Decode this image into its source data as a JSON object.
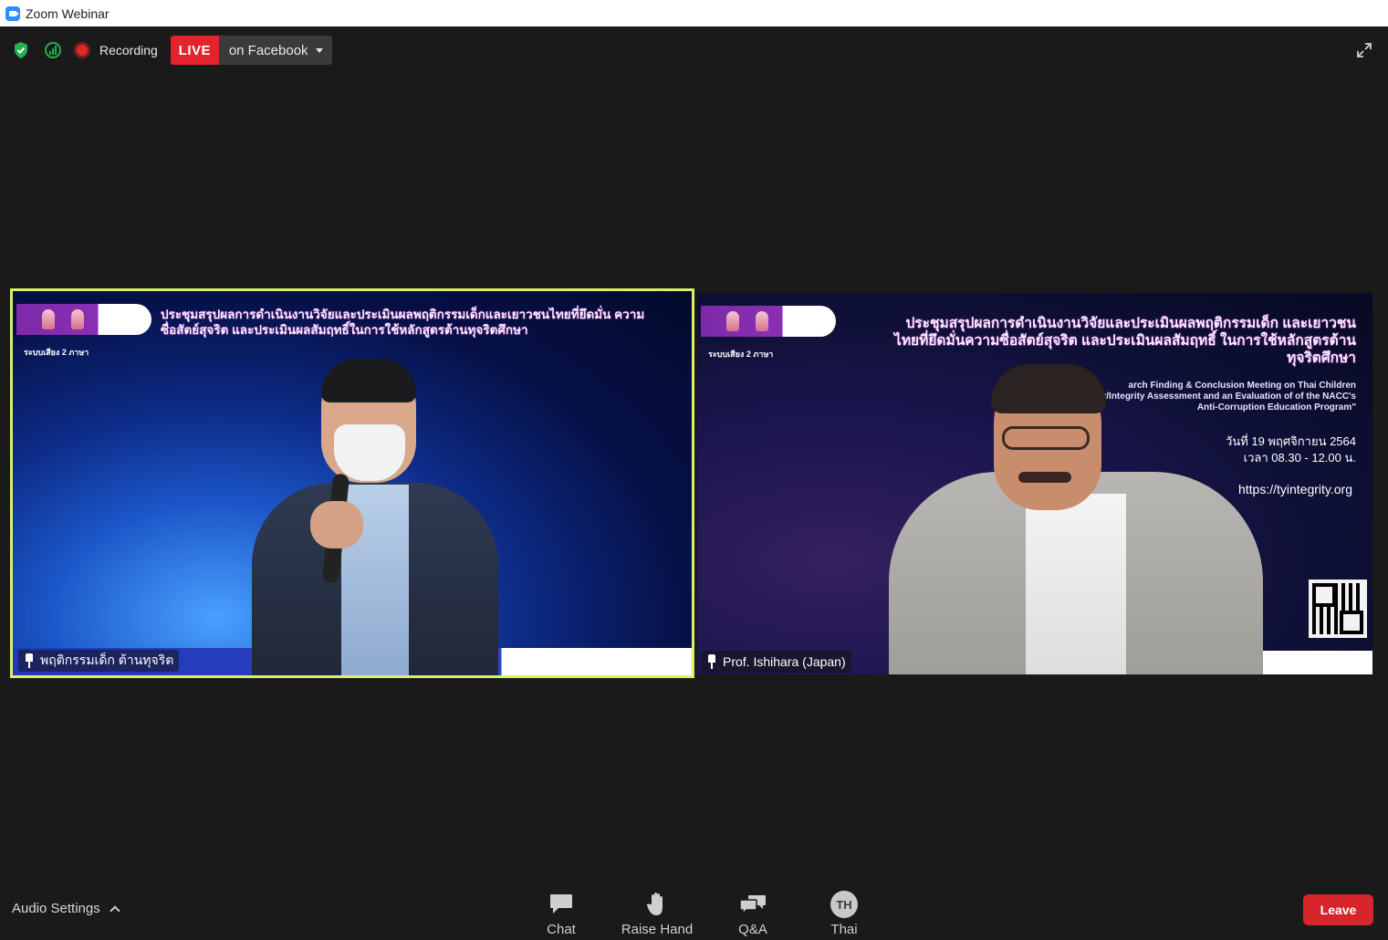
{
  "window": {
    "title": "Zoom Webinar"
  },
  "topbar": {
    "recording_label": "Recording",
    "live_badge": "LIVE",
    "live_destination": "on Facebook"
  },
  "tiles": [
    {
      "name": "พฤติกรรมเด็ก ต้านทุจริต",
      "slide_title": "ประชุมสรุปผลการดำเนินงานวิจัยและประเมินผลพฤติกรรมเด็กและเยาวชนไทยที่ยึดมั่น ความซื่อสัตย์สุจริต และประเมินผลสัมฤทธิ์ในการใช้หลักสูตรต้านทุจริตศึกษา",
      "dual_language": "ระบบเสียง 2 ภาษา"
    },
    {
      "name": "Prof. Ishihara (Japan)",
      "slide_title": "ประชุมสรุปผลการดำเนินงานวิจัยและประเมินผลพฤติกรรมเด็ก และเยาวชนไทยที่ยึดมั่นความซื่อสัตย์สุจริต และประเมินผลสัมฤทธิ์ ในการใช้หลักสูตรต้านทุจริตศึกษา",
      "english_text": "arch Finding & Conclusion Meeting on Thai Children Honesty/Integrity Assessment and an Evaluation of of the NACC's Anti-Corruption Education Program\"",
      "date": "วันที่ 19 พฤศจิกายน 2564",
      "time": "เวลา 08.30 - 12.00 น.",
      "url": "https://tyintegrity.org",
      "dual_language": "ระบบเสียง 2 ภาษา"
    }
  ],
  "bottom": {
    "audio_settings": "Audio Settings",
    "chat": "Chat",
    "raise_hand": "Raise Hand",
    "qa": "Q&A",
    "language_code": "TH",
    "language": "Thai",
    "leave": "Leave"
  },
  "colors": {
    "live_red": "#e4242c",
    "leave_red": "#d6262c",
    "active_speaker_border": "#d9ef6a",
    "background": "#1a1a1a"
  }
}
